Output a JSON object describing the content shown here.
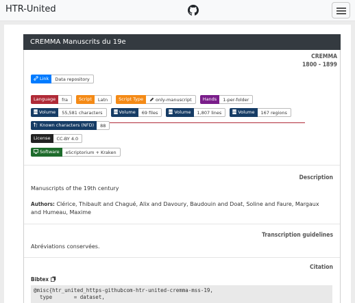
{
  "navbar": {
    "brand": "HTR-United",
    "github_icon": "github-icon",
    "menu_icon": "hamburger-icon"
  },
  "card": {
    "title": "CREMMA Manuscrits du 19e",
    "project": "CREMMA",
    "dates": "1800 - 1899",
    "link": {
      "label": "Link",
      "value": "Data repository"
    },
    "row2": [
      {
        "label": "Language",
        "value": "fra",
        "color": "#b02a37"
      },
      {
        "label": "Script",
        "value": "Latn",
        "color": "#f48a16"
      },
      {
        "label": "Script Type",
        "value": "only-manuscript",
        "color": "#f48a16"
      },
      {
        "label": "Hands",
        "value": "1-per-folder",
        "color": "#7a1d8a"
      }
    ],
    "volumes": [
      {
        "label": "Volume",
        "value": "55,581 characters"
      },
      {
        "label": "Volume",
        "value": "69 files"
      },
      {
        "label": "Volume",
        "value": "1,807 lines"
      },
      {
        "label": "Volume",
        "value": "167 regions"
      }
    ],
    "known_chars": {
      "label": "Known characters (NFD)",
      "value": "88"
    },
    "license": {
      "label": "License",
      "value": "CC-BY 4.0"
    },
    "software": {
      "label": "Software",
      "value": "eScriptorium + Kraken"
    },
    "description": {
      "title": "Description",
      "text": "Manuscripts of the 19th century",
      "authors_label": "Authors:",
      "authors_line1": "Clérice, Thibault and Chagué, Alix and Davoury, Baudouin and Doat, Soline and Faure, Margaux",
      "authors_line2": "and Humeau, Maxime"
    },
    "guidelines": {
      "title": "Transcription guidelines",
      "text": "Abréviations conservées."
    },
    "citation": {
      "title": "Citation",
      "bibtex_label": "Bibtex",
      "line1": "@misc{htr_united_https-githubcom-htr-united-cremma-mss-19,",
      "line2": "  type       = dataset,"
    }
  }
}
